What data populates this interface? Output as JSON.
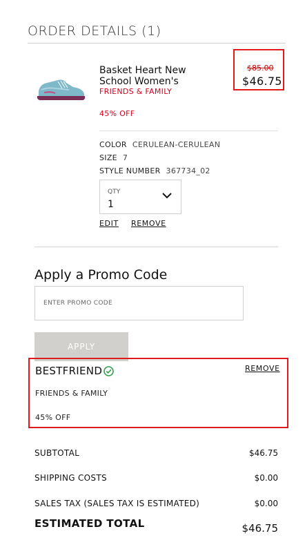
{
  "order": {
    "title": "ORDER DETAILS (1)"
  },
  "item": {
    "name": "Basket Heart New School Women's",
    "tag": "FRIENDS & FAMILY",
    "discount": "45% OFF",
    "price_original": "$85.00",
    "price_sale": "$46.75",
    "image_icon": "sneaker-image",
    "attributes": {
      "color_label": "COLOR",
      "color_value": "CERULEAN-CERULEAN",
      "size_label": "SIZE",
      "size_value": "7",
      "style_label": "STYLE NUMBER",
      "style_value": "367734_02"
    },
    "qty_label": "QTY",
    "qty_value": "1",
    "edit_label": "EDIT",
    "remove_label": "REMOVE"
  },
  "promo": {
    "heading": "Apply a Promo Code",
    "placeholder": "ENTER PROMO CODE",
    "apply_label": "APPLY",
    "applied": {
      "code": "BESTFRIEND",
      "remove_label": "REMOVE",
      "tag": "FRIENDS & FAMILY",
      "discount": "45% OFF"
    }
  },
  "summary": {
    "subtotal_label": "SUBTOTAL",
    "subtotal_value": "$46.75",
    "shipping_label": "SHIPPING COSTS",
    "shipping_value": "$0.00",
    "tax_label": "SALES TAX (SALES TAX IS ESTIMATED)",
    "tax_value": "$0.00",
    "total_label": "ESTIMATED TOTAL",
    "total_value": "$46.75"
  },
  "colors": {
    "sale_red": "#d0021b",
    "highlight_red": "#e0191b",
    "apply_bg": "#d2d0cd",
    "check_green": "#2e9e4f"
  }
}
